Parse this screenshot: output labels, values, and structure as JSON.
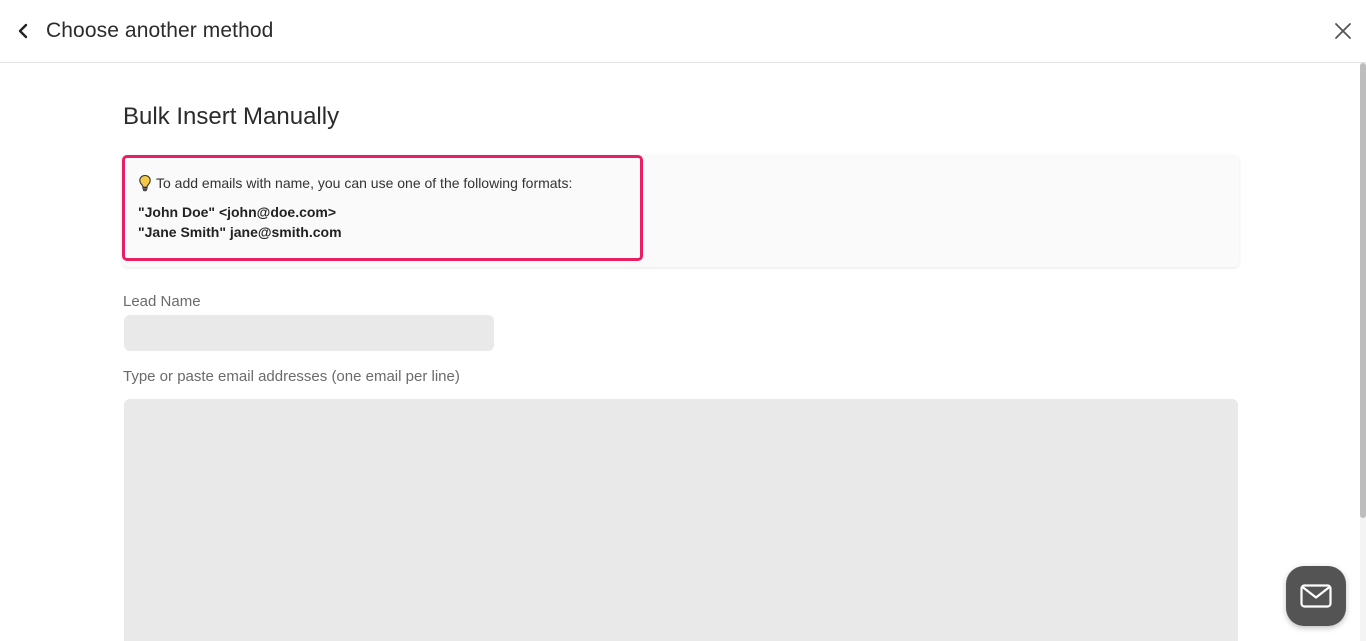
{
  "header": {
    "back_icon": "chevron-left-icon",
    "title": "Choose another method",
    "close_icon": "close-icon"
  },
  "main": {
    "title": "Bulk Insert Manually",
    "info": {
      "icon": "lightbulb-icon",
      "hint": "To add emails with name, you can use one of the following formats:",
      "examples": [
        "\"John Doe\" <john@doe.com>",
        "\"Jane Smith\" jane@smith.com"
      ],
      "highlight_color": "#e91e63"
    },
    "lead_name": {
      "label": "Lead Name",
      "value": "",
      "placeholder": ""
    },
    "emails": {
      "label": "Type or paste email addresses (one email per line)",
      "value": "",
      "placeholder": ""
    }
  },
  "chat": {
    "icon": "mail-icon",
    "color": "#545454"
  }
}
